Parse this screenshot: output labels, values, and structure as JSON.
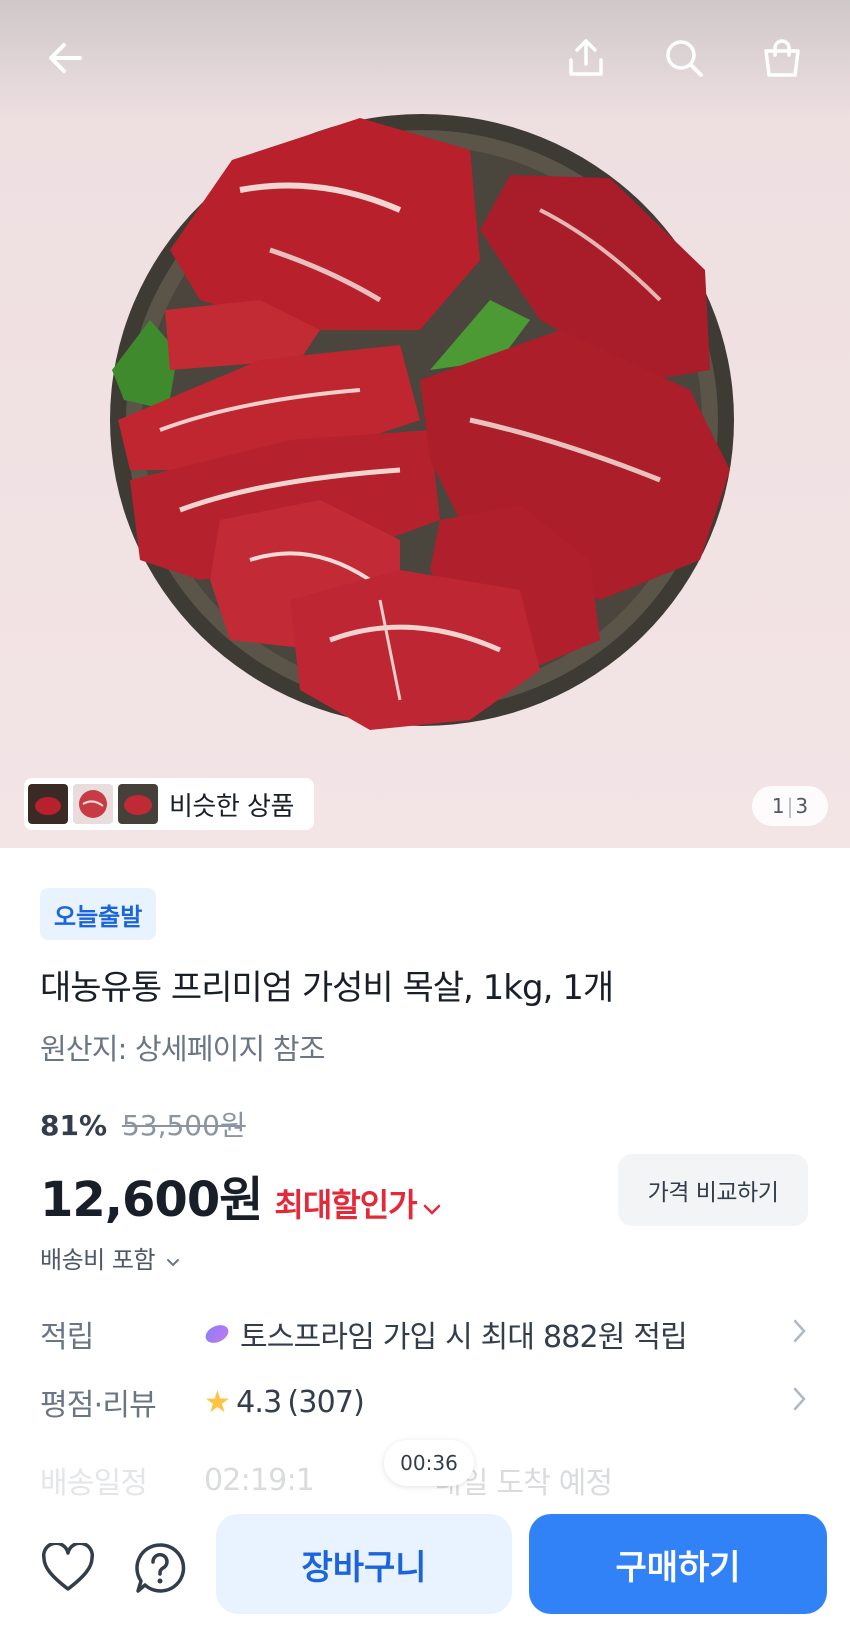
{
  "topbar": {
    "icons": [
      "back-arrow-icon",
      "share-icon",
      "search-icon",
      "shopping-bag-icon"
    ]
  },
  "gallery": {
    "current": "1",
    "total": "3",
    "similar_label": "비슷한 상품"
  },
  "product": {
    "badge": "오늘출발",
    "title": "대농유통 프리미엄 가성비 목살, 1kg, 1개",
    "origin": "원산지: 상세페이지 참조",
    "discount_pct": "81%",
    "original_price": "53,500원",
    "price": "12,600원",
    "max_discount_label": "최대할인가",
    "compare_label": "가격 비교하기",
    "shipping_label": "배송비 포함"
  },
  "info_rows": {
    "reward_key": "적립",
    "reward_value": "토스프라임 가입 시 최대 882원 적립",
    "rating_key": "평점·리뷰",
    "rating_value": "4.3",
    "review_count": "(307)",
    "delivery_key": "배송일정",
    "delivery_value": "02:19:1",
    "delivery_suffix": "내일 도착 예정"
  },
  "timer": "00:36",
  "bottom": {
    "cart_label": "장바구니",
    "buy_label": "구매하기"
  },
  "colors": {
    "accent": "#3182f6",
    "accent_light": "#e8f3ff",
    "discount_red": "#e42939",
    "star": "#ffc342"
  }
}
